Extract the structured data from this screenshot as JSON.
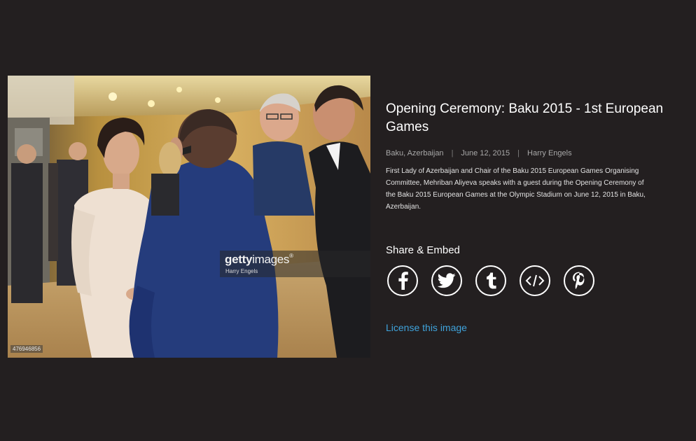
{
  "photo": {
    "alt_people": "photo",
    "watermark_brand_bold": "getty",
    "watermark_brand_rest": "images",
    "watermark_mark": "®",
    "watermark_photographer": "Harry Engels",
    "image_id": "476946856"
  },
  "info": {
    "title": "Opening Ceremony: Baku 2015 - 1st European Games",
    "location": "Baku, Azerbaijan",
    "date": "June 12, 2015",
    "photographer": "Harry Engels",
    "caption_lines": [
      "First Lady of Azerbaijan and Chair of the Baku 2015 European Games Organising",
      "Committee, Mehriban Aliyeva speaks with a guest during the Opening Ceremony of",
      "the Baku 2015 European Games at the Olympic Stadium on June 12, 2015 in Baku,",
      "Azerbaijan."
    ]
  },
  "share": {
    "title": "Share & Embed",
    "buttons": [
      {
        "icon": "facebook-icon"
      },
      {
        "icon": "twitter-icon"
      },
      {
        "icon": "tumblr-icon"
      },
      {
        "icon": "embed-code-icon"
      },
      {
        "icon": "pinterest-icon"
      }
    ]
  },
  "license": {
    "label": "License this image"
  },
  "colors": {
    "background": "#231f20",
    "link": "#3fa3db",
    "text": "#ffffff",
    "meta": "#a8a8a8"
  }
}
